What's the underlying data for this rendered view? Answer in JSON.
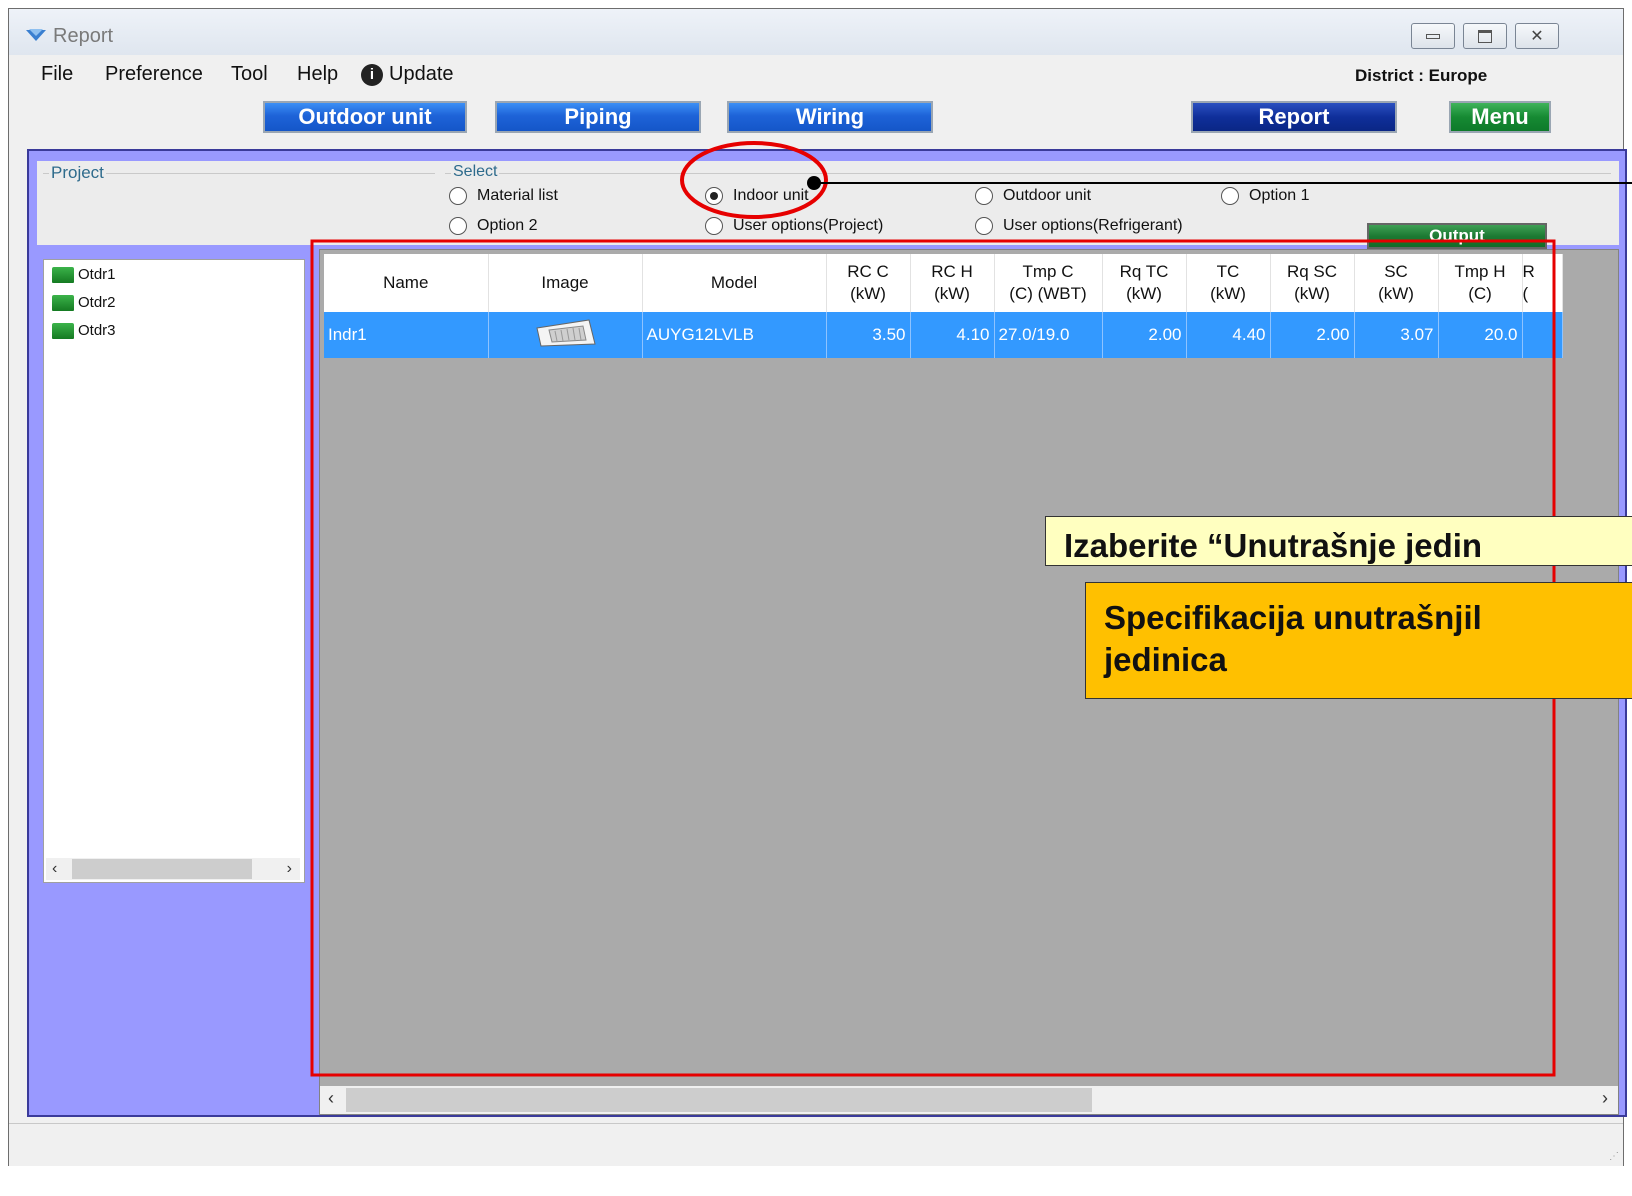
{
  "window": {
    "title": "Report"
  },
  "menu": {
    "file": "File",
    "preference": "Preference",
    "tool": "Tool",
    "help": "Help",
    "update": "Update"
  },
  "district": "District : Europe",
  "nav": {
    "outdoor": "Outdoor unit",
    "piping": "Piping",
    "wiring": "Wiring",
    "report": "Report",
    "menu": "Menu"
  },
  "panel": {
    "project_label": "Project",
    "select_label": "Select",
    "options": {
      "material_list": "Material list",
      "option2": "Option 2",
      "indoor_unit": "Indoor unit",
      "user_options_project": "User options(Project)",
      "outdoor_unit": "Outdoor unit",
      "user_options_refrigerant": "User options(Refrigerant)",
      "option1": "Option 1"
    },
    "selected": "indoor_unit",
    "output": "Output"
  },
  "tree": {
    "items": [
      "Otdr1",
      "Otdr2",
      "Otdr3"
    ]
  },
  "grid": {
    "headers": [
      [
        "Name"
      ],
      [
        "Image"
      ],
      [
        "Model"
      ],
      [
        "RC C",
        "(kW)"
      ],
      [
        "RC H",
        "(kW)"
      ],
      [
        "Tmp C",
        "(C) (WBT)"
      ],
      [
        "Rq TC",
        "(kW)"
      ],
      [
        "TC",
        "(kW)"
      ],
      [
        "Rq SC",
        "(kW)"
      ],
      [
        "SC",
        "(kW)"
      ],
      [
        "Tmp H",
        "(C)"
      ],
      [
        "R",
        "("
      ]
    ],
    "row": {
      "name": "Indr1",
      "model": "AUYG12LVLB",
      "rcc": "3.50",
      "rch": "4.10",
      "tmpc": "27.0/19.0",
      "rqtc": "2.00",
      "tc": "4.40",
      "rqsc": "2.00",
      "sc": "3.07",
      "tmph": "20.0"
    }
  },
  "callouts": {
    "select_indoor": "Izaberite “Unutrašnje jedin",
    "spec_line1": "Specifikacija unutrašnjil",
    "spec_line2": "jedinica"
  },
  "colors": {
    "selection": "#3399ff",
    "annotation_red": "#e60000",
    "panel_purple": "#9999ff"
  }
}
